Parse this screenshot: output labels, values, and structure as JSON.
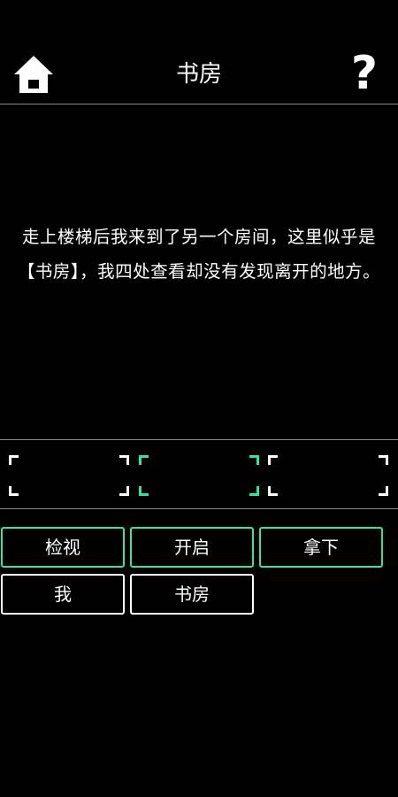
{
  "header": {
    "title": "书房",
    "home_icon": "home-icon",
    "help_label": "?"
  },
  "story": {
    "text": "走上楼梯后我来到了另一个房间，这里似乎是【书房】，我四处查看却没有发现离开的地方。"
  },
  "inventory": {
    "slots": [
      {
        "selected": false
      },
      {
        "selected": true
      },
      {
        "selected": false
      }
    ]
  },
  "actions": {
    "row1": [
      {
        "label": "检视"
      },
      {
        "label": "开启"
      },
      {
        "label": "拿下"
      }
    ],
    "row2": [
      {
        "label": "我"
      },
      {
        "label": "书房"
      }
    ]
  },
  "colors": {
    "background": "#000000",
    "text": "#ffffff",
    "accent": "#2ee6a0",
    "divider": "#8a8a8a"
  }
}
